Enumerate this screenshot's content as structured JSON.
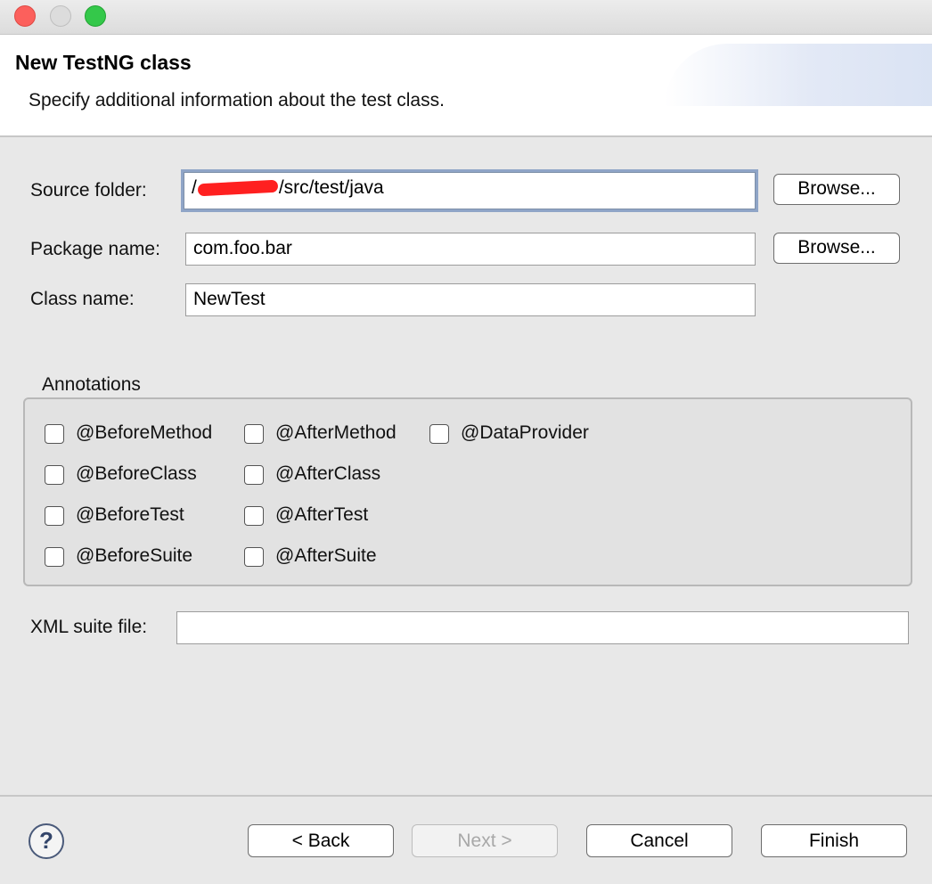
{
  "window": {
    "controls": {
      "close": "close-window",
      "minimize": "minimize-window",
      "zoom": "zoom-window"
    }
  },
  "header": {
    "title": "New TestNG class",
    "description": "Specify additional information about the test class."
  },
  "form": {
    "source_folder": {
      "label": "Source folder:",
      "value_prefix": "/",
      "value_suffix": "/src/test/java",
      "browse_label": "Browse..."
    },
    "package_name": {
      "label": "Package name:",
      "value": "com.foo.bar",
      "browse_label": "Browse..."
    },
    "class_name": {
      "label": "Class name:",
      "value": "NewTest"
    },
    "xml_suite_file": {
      "label": "XML suite file:",
      "value": ""
    }
  },
  "annotations": {
    "title": "Annotations",
    "items": [
      {
        "label": "@BeforeMethod",
        "checked": false
      },
      {
        "label": "@AfterMethod",
        "checked": false
      },
      {
        "label": "@DataProvider",
        "checked": false
      },
      {
        "label": "@BeforeClass",
        "checked": false
      },
      {
        "label": "@AfterClass",
        "checked": false
      },
      {
        "label": "@BeforeTest",
        "checked": false
      },
      {
        "label": "@AfterTest",
        "checked": false
      },
      {
        "label": "@BeforeSuite",
        "checked": false
      },
      {
        "label": "@AfterSuite",
        "checked": false
      }
    ]
  },
  "footer": {
    "help": "?",
    "back": "< Back",
    "next": "Next >",
    "cancel": "Cancel",
    "finish": "Finish"
  },
  "colors": {
    "close": "#fc605c",
    "minimize": "#dcdcdc",
    "zoom": "#34c84a",
    "focus_ring": "#8fa5c7",
    "redaction": "#ff2020"
  }
}
